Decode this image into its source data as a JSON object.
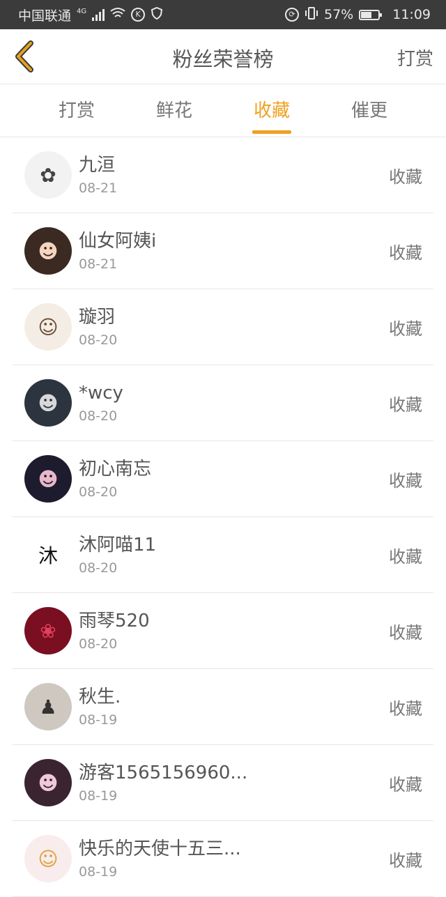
{
  "status": {
    "carrier": "中国联通",
    "network": "4G",
    "battery": "57%",
    "time": "11:09"
  },
  "header": {
    "title": "粉丝荣誉榜",
    "action": "打赏"
  },
  "tabs": [
    {
      "label": "打赏",
      "active": false
    },
    {
      "label": "鲜花",
      "active": false
    },
    {
      "label": "收藏",
      "active": true
    },
    {
      "label": "催更",
      "active": false
    }
  ],
  "fans": [
    {
      "name": "九洹",
      "date": "08-21",
      "type": "收藏",
      "avatar_bg": "#f2f2f2",
      "avatar_fg": "#444",
      "avatar_glyph": "✿"
    },
    {
      "name": "仙女阿姨i",
      "date": "08-21",
      "type": "收藏",
      "avatar_bg": "#3a2a22",
      "avatar_fg": "#f5d5c0",
      "avatar_glyph": "☻"
    },
    {
      "name": "璇羽",
      "date": "08-20",
      "type": "收藏",
      "avatar_bg": "#f3ede6",
      "avatar_fg": "#6b4b33",
      "avatar_glyph": "☺"
    },
    {
      "name": "*wcy",
      "date": "08-20",
      "type": "收藏",
      "avatar_bg": "#2c3440",
      "avatar_fg": "#d8d8d8",
      "avatar_glyph": "☻"
    },
    {
      "name": "初心南忘",
      "date": "08-20",
      "type": "收藏",
      "avatar_bg": "#1d1b2e",
      "avatar_fg": "#e8b8c8",
      "avatar_glyph": "☻"
    },
    {
      "name": "沐阿喵11",
      "date": "08-20",
      "type": "收藏",
      "avatar_bg": "#ffffff",
      "avatar_fg": "#111",
      "avatar_glyph": "沐"
    },
    {
      "name": "雨琴520",
      "date": "08-20",
      "type": "收藏",
      "avatar_bg": "#7a0f22",
      "avatar_fg": "#e0405a",
      "avatar_glyph": "❀"
    },
    {
      "name": "秋生.",
      "date": "08-19",
      "type": "收藏",
      "avatar_bg": "#cfc8c0",
      "avatar_fg": "#333",
      "avatar_glyph": "♟"
    },
    {
      "name": "游客1565156960...",
      "date": "08-19",
      "type": "收藏",
      "avatar_bg": "#3a2430",
      "avatar_fg": "#f0c8d8",
      "avatar_glyph": "☻"
    },
    {
      "name": "快乐的天使十五三...",
      "date": "08-19",
      "type": "收藏",
      "avatar_bg": "#f8ecec",
      "avatar_fg": "#e0a040",
      "avatar_glyph": "☺"
    }
  ],
  "colors": {
    "accent": "#f0a020",
    "back_arrow": "#e8a020",
    "status_bar": "#3b3b3b"
  }
}
